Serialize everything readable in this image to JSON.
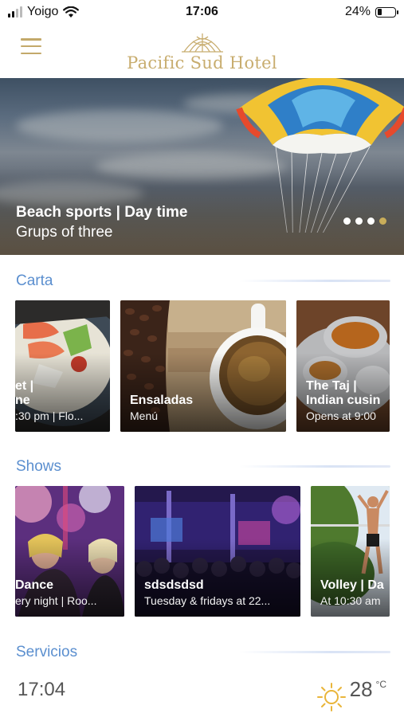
{
  "status_bar": {
    "carrier": "Yoigo",
    "time": "17:06",
    "battery_percent": "24%",
    "battery_level": 0.24,
    "icons": [
      "signal-icon",
      "wifi-icon",
      "battery-icon"
    ]
  },
  "header": {
    "hotel_name": "Pacific Sud Hotel",
    "menu_icon": "hamburger-menu-icon",
    "accent_color": "#c8ad6f"
  },
  "hero": {
    "title": "Beach sports | Day time",
    "subtitle": "Grups of three",
    "slide_count": 4,
    "active_slide": 4
  },
  "sections": {
    "carta": {
      "title": "Carta",
      "cards": [
        {
          "title": "et |",
          "title2": "ne",
          "subtitle": ":30 pm | Flo..."
        },
        {
          "title": "Ensaladas",
          "subtitle": "Menú"
        },
        {
          "title": "The Taj |",
          "title2": "Indian cusin",
          "subtitle": "Opens at 9:00"
        }
      ]
    },
    "shows": {
      "title": "Shows",
      "cards": [
        {
          "title": "Dance",
          "subtitle": "ery night | Roo..."
        },
        {
          "title": "sdsdsdsd",
          "subtitle": "Tuesday & fridays at 22..."
        },
        {
          "title": "Volley | Da",
          "subtitle": "At 10:30 am"
        }
      ]
    },
    "servicios": {
      "title": "Servicios"
    }
  },
  "footer": {
    "time": "17:04",
    "temperature": "28",
    "unit": "°C",
    "weather_icon": "sun-icon"
  },
  "colors": {
    "section_title": "#5b8fcf",
    "active_dot": "#c9ad5a"
  }
}
